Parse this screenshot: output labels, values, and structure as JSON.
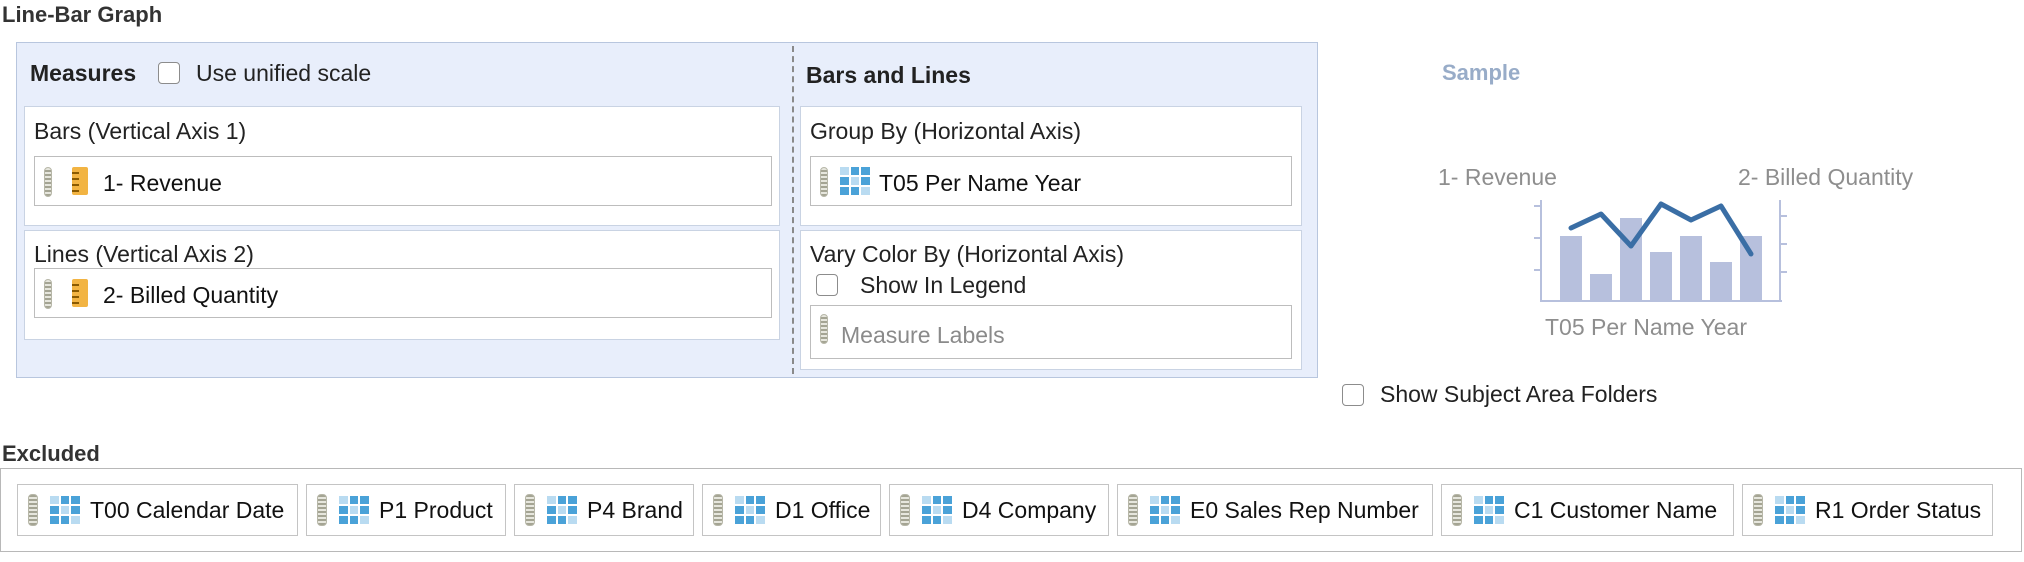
{
  "page_title": "Line-Bar Graph",
  "measures": {
    "title": "Measures",
    "unified_scale_label": "Use unified scale",
    "bars": {
      "title": "Bars (Vertical Axis 1)",
      "item": "1- Revenue"
    },
    "lines": {
      "title": "Lines (Vertical Axis 2)",
      "item": "2- Billed Quantity"
    }
  },
  "bars_and_lines": {
    "title": "Bars and Lines",
    "group_by": {
      "title": "Group By (Horizontal Axis)",
      "item": "T05 Per Name Year"
    },
    "vary_color": {
      "title": "Vary Color By (Horizontal Axis)",
      "show_in_legend_label": "Show In Legend",
      "item": "Measure Labels"
    }
  },
  "sample": {
    "title": "Sample",
    "left_label": "1- Revenue",
    "right_label": "2- Billed Quantity",
    "bottom_label": "T05 Per Name Year"
  },
  "show_subject_area_folders_label": "Show Subject Area Folders",
  "excluded": {
    "title": "Excluded",
    "items": [
      "T00 Calendar Date",
      "P1 Product",
      "P4 Brand",
      "D1 Office",
      "D4 Company",
      "E0 Sales Rep Number",
      "C1 Customer Name",
      "R1 Order Status"
    ]
  },
  "colors": {
    "panel_bg": "#e8eefb",
    "sample_bar": "#b7c0dd",
    "sample_line": "#3a6ea5",
    "measure_icon": "#f2b443",
    "column_icon": "#4aa2d8"
  }
}
